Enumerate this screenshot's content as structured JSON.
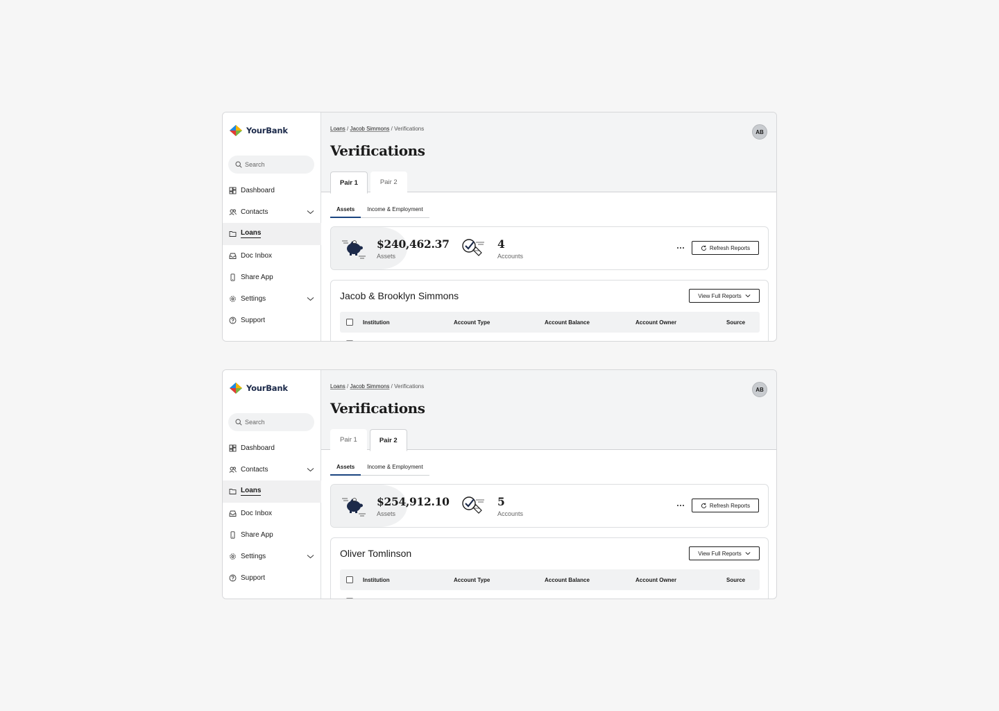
{
  "brand": {
    "name": "YourBank"
  },
  "search": {
    "placeholder": "Search"
  },
  "sidebar": {
    "items": [
      {
        "label": "Dashboard",
        "icon": "dashboard-icon"
      },
      {
        "label": "Contacts",
        "icon": "contacts-icon",
        "expandable": true
      },
      {
        "label": "Loans",
        "icon": "folder-icon",
        "active": true
      },
      {
        "label": "Doc Inbox",
        "icon": "inbox-icon"
      },
      {
        "label": "Share App",
        "icon": "phone-icon"
      },
      {
        "label": "Settings",
        "icon": "gear-icon",
        "expandable": true
      },
      {
        "label": "Support",
        "icon": "help-icon"
      }
    ]
  },
  "breadcrumb": {
    "loans": "Loans",
    "contact": "Jacob Simmons",
    "sep": "/",
    "current": "Verifications"
  },
  "avatar": {
    "initials": "AB"
  },
  "page_title": "Verifications",
  "pair_tabs": [
    "Pair 1",
    "Pair 2"
  ],
  "subtabs": [
    "Assets",
    "Income & Employment"
  ],
  "buttons": {
    "refresh": "Refresh Reports",
    "view_full": "View Full Reports"
  },
  "table": {
    "headers": [
      "Institution",
      "Account Type",
      "Account Balance",
      "Account Owner",
      "Source"
    ]
  },
  "frames": [
    {
      "active_pair": 0,
      "assets_amount": "$240,462.37",
      "assets_label": "Assets",
      "accounts_count": "4",
      "accounts_label": "Accounts",
      "owner_name": "Jacob & Brooklyn Simmons"
    },
    {
      "active_pair": 1,
      "assets_amount": "$254,912.10",
      "assets_label": "Assets",
      "accounts_count": "5",
      "accounts_label": "Accounts",
      "owner_name": "Oliver Tomlinson"
    }
  ],
  "colors": {
    "accent": "#1a4480",
    "brand_navy": "#1c2a4a",
    "header_bg": "#f3f4f5"
  }
}
